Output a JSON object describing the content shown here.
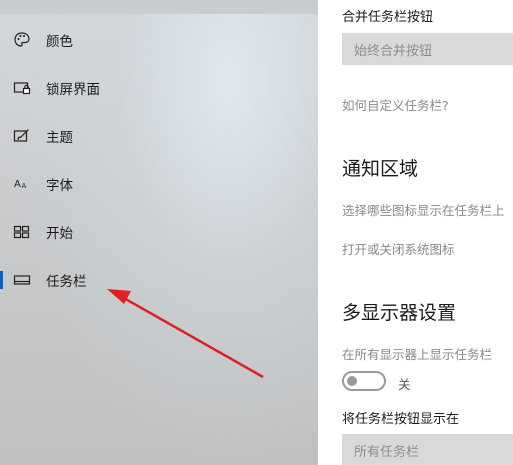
{
  "sidebar": {
    "items": [
      {
        "label": "颜色",
        "icon": "palette-icon"
      },
      {
        "label": "锁屏界面",
        "icon": "lockscreen-icon"
      },
      {
        "label": "主题",
        "icon": "theme-brush-icon"
      },
      {
        "label": "字体",
        "icon": "font-icon"
      },
      {
        "label": "开始",
        "icon": "start-grid-icon"
      },
      {
        "label": "任务栏",
        "icon": "taskbar-icon",
        "selected": true
      }
    ]
  },
  "main": {
    "combine_label": "合并任务栏按钮",
    "combine_value": "始终合并按钮",
    "customize_link": "如何自定义任务栏?",
    "notify_heading": "通知区域",
    "notify_link_icons": "选择哪些图标显示在任务栏上",
    "notify_link_system": "打开或关闭系统图标",
    "multi_heading": "多显示器设置",
    "multi_show_label": "在所有显示器上显示任务栏",
    "multi_toggle_state": "关",
    "multi_buttons_label": "将任务栏按钮显示在",
    "multi_buttons_value": "所有任务栏"
  },
  "colors": {
    "accent": "#0a62c9",
    "annotation_arrow": "#e02020"
  }
}
